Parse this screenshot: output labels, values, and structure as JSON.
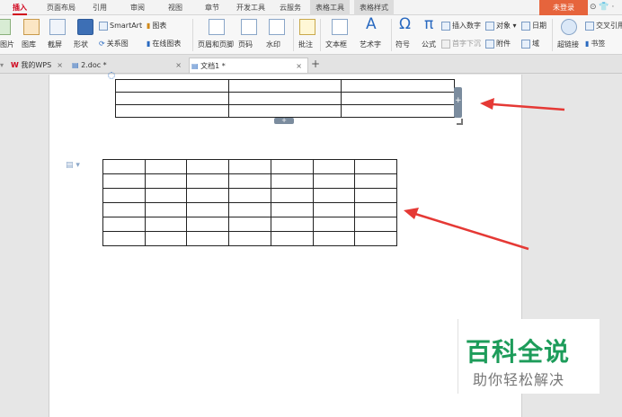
{
  "ribbon_tabs": [
    {
      "label": "插入",
      "active": true
    },
    {
      "label": "页面布局"
    },
    {
      "label": "引用"
    },
    {
      "label": "审阅"
    },
    {
      "label": "视图"
    },
    {
      "label": "章节"
    },
    {
      "label": "开发工具"
    },
    {
      "label": "云服务"
    },
    {
      "label": "表格工具"
    },
    {
      "label": "表格样式"
    }
  ],
  "login": "未登录",
  "toolbar": {
    "picture": "图片",
    "gallery": "图库",
    "screenshot": "截屏",
    "shapes": "形状",
    "smartart": "SmartArt",
    "relation_chart": "关系图",
    "chart": "图表",
    "online_chart": "在线图表",
    "header_footer": "页眉和页脚",
    "page_number": "页码",
    "watermark": "水印",
    "comment": "批注",
    "textbox": "文本框",
    "wordart": "艺术字",
    "symbol": "符号",
    "formula": "公式",
    "insert_number": "插入数字",
    "first_letter_sink": "首字下沉",
    "object": "对象",
    "attachment": "附件",
    "date": "日期",
    "field": "域",
    "hyperlink": "超链接",
    "bookmark": "书签",
    "cross_ref": "交叉引用"
  },
  "doc_tabs": [
    {
      "label": "我的WPS"
    },
    {
      "label": "2.doc *"
    },
    {
      "label": "文档1 *",
      "selected": true
    }
  ],
  "watermark_brand": {
    "title": "百科全说",
    "subtitle": "助你轻松解决"
  },
  "colors": {
    "accent_red": "#d0021b",
    "login_orange": "#e6643c",
    "brand_green": "#1d9c5a",
    "arrow_red": "#e53935"
  }
}
